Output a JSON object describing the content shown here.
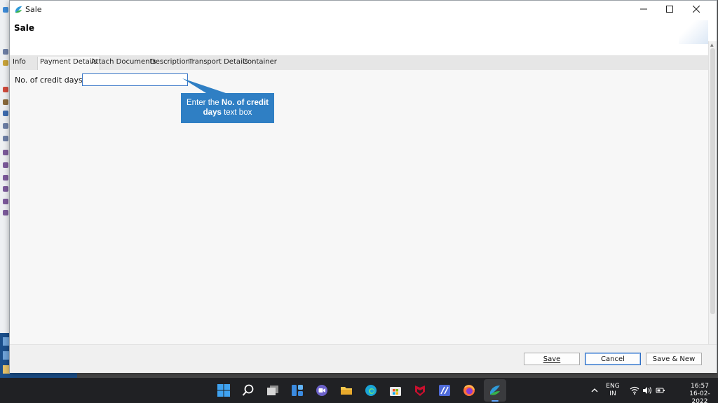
{
  "window": {
    "title": "Sale",
    "controls": {
      "minimize": "—",
      "maximize": "☐",
      "close": "✕"
    }
  },
  "header": {
    "title": "Sale"
  },
  "tabs": [
    {
      "label": "Info",
      "active": false
    },
    {
      "label": "Payment Details",
      "active": true
    },
    {
      "label": "Attach Documents",
      "active": false
    },
    {
      "label": "Description",
      "active": false
    },
    {
      "label": "Transport Details",
      "active": false
    },
    {
      "label": "Container",
      "active": false
    }
  ],
  "form": {
    "credit_days_label": "No. of credit days",
    "credit_days_value": "",
    "credit_days_placeholder": ""
  },
  "callout": {
    "prefix": "Enter the ",
    "bold1": "No. of credit",
    "bold2": "days",
    "suffix": " text box",
    "color": "#2f7fc4"
  },
  "footer": {
    "save_label": "Save",
    "cancel_label": "Cancel",
    "save_new_label": "Save & New"
  },
  "taskbar": {
    "icons": [
      "windows-start-icon",
      "search-icon",
      "task-view-icon",
      "widgets-icon",
      "teams-chat-icon",
      "file-explorer-icon",
      "edge-browser-icon",
      "microsoft-store-icon",
      "mcafee-icon",
      "writing-app-icon",
      "firefox-icon",
      "sale-app-icon"
    ],
    "language_line1": "ENG",
    "language_line2": "IN",
    "time": "16:57",
    "date": "16-02-2022"
  }
}
